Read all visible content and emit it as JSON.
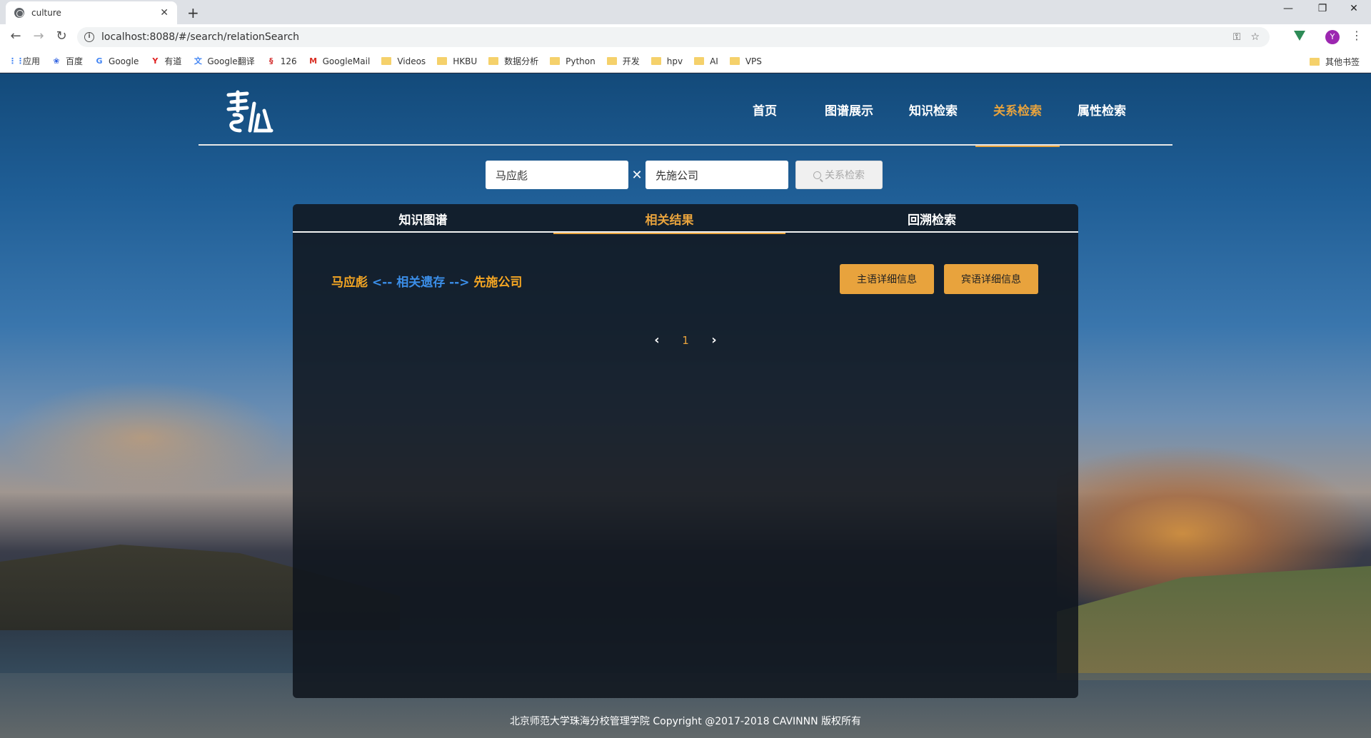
{
  "browser": {
    "tab_title": "culture",
    "tab_close": "✕",
    "new_tab": "+",
    "url": "localhost:8088/#/search/relationSearch",
    "avatar_letter": "Y",
    "window_controls": [
      "—",
      "❐",
      "✕"
    ],
    "nav": {
      "back": "←",
      "forward": "→",
      "reload": "↻"
    }
  },
  "bookmarks": [
    {
      "label": "应用",
      "icon": "apps-grid-icon",
      "color": "#4285f4"
    },
    {
      "label": "百度",
      "icon": "baidu-paw-icon",
      "color": "#3062e1"
    },
    {
      "label": "Google",
      "icon": "google-g-icon",
      "color": "#4285f4"
    },
    {
      "label": "有道",
      "icon": "youdao-icon",
      "color": "#e02020"
    },
    {
      "label": "Google翻译",
      "icon": "translate-icon",
      "color": "#4285f4"
    },
    {
      "label": "126",
      "icon": "netease-126-icon",
      "color": "#d32f2f"
    },
    {
      "label": "GoogleMail",
      "icon": "gmail-icon",
      "color": "#d93025"
    },
    {
      "label": "Videos",
      "icon": "folder-icon"
    },
    {
      "label": "HKBU",
      "icon": "folder-icon"
    },
    {
      "label": "数据分析",
      "icon": "folder-icon"
    },
    {
      "label": "Python",
      "icon": "folder-icon"
    },
    {
      "label": "开发",
      "icon": "folder-icon"
    },
    {
      "label": "hpv",
      "icon": "folder-icon"
    },
    {
      "label": "AI",
      "icon": "folder-icon"
    },
    {
      "label": "VPS",
      "icon": "folder-icon"
    }
  ],
  "other_bookmarks": "其他书签",
  "site": {
    "nav": [
      {
        "label": "首页",
        "active": false
      },
      {
        "label": "图谱展示",
        "active": false
      },
      {
        "label": "知识检索",
        "active": false
      },
      {
        "label": "关系检索",
        "active": true
      },
      {
        "label": "属性检索",
        "active": false
      }
    ],
    "search": {
      "entity_a": "马应彪",
      "separator": "✕",
      "entity_b": "先施公司",
      "button_label": "关系检索"
    },
    "tabs": [
      {
        "label": "知识图谱",
        "active": false
      },
      {
        "label": "相关结果",
        "active": true
      },
      {
        "label": "回溯检索",
        "active": false
      }
    ],
    "result": {
      "subject": "马应彪",
      "arrow_left": "<--",
      "relation": "相关遗存",
      "arrow_right": "-->",
      "object": "先施公司",
      "subject_button": "主语详细信息",
      "object_button": "宾语详细信息"
    },
    "pagination": {
      "prev": "‹",
      "current": "1",
      "next": "›"
    },
    "footer": "北京师范大学珠海分校管理学院 Copyright @2017-2018 CAVINNN 版权所有"
  },
  "colors": {
    "accent": "#e8a33d",
    "relation_blue": "#3b8ee8",
    "entity_orange": "#f5a623"
  }
}
